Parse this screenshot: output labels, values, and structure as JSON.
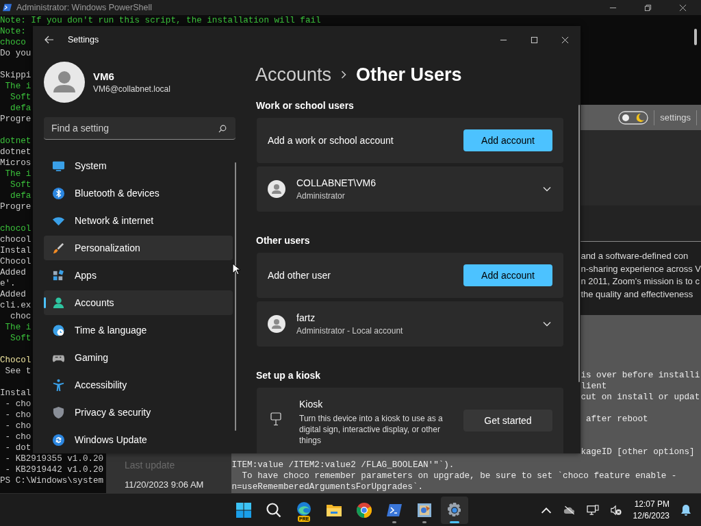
{
  "powershell": {
    "title": "Administrator: Windows PowerShell",
    "left_lines": [
      {
        "kind": "note",
        "text": "Note: If you don't run this script, the installation will fail"
      },
      {
        "kind": "note",
        "text": "Note:"
      },
      {
        "kind": "note",
        "text": "choco"
      },
      {
        "kind": "plain",
        "text": "Do you"
      },
      {
        "kind": "blank"
      },
      {
        "kind": "plain",
        "text": "Skippi"
      },
      {
        "kind": "note",
        "text": " The i"
      },
      {
        "kind": "note",
        "text": "  Soft"
      },
      {
        "kind": "note",
        "text": "  defa"
      },
      {
        "kind": "plain",
        "text": "Progre"
      },
      {
        "kind": "blank"
      },
      {
        "kind": "note",
        "text": "dotnet"
      },
      {
        "kind": "plain",
        "text": "dotnet"
      },
      {
        "kind": "plain",
        "text": "Micros"
      },
      {
        "kind": "note",
        "text": " The i"
      },
      {
        "kind": "note",
        "text": "  Soft"
      },
      {
        "kind": "note",
        "text": "  defa"
      },
      {
        "kind": "plain",
        "text": "Progre"
      },
      {
        "kind": "blank"
      },
      {
        "kind": "note",
        "text": "chocol"
      },
      {
        "kind": "plain",
        "text": "chocol"
      },
      {
        "kind": "plain",
        "text": "Instal"
      },
      {
        "kind": "plain",
        "text": "Chocol"
      },
      {
        "kind": "plain",
        "text": "Added"
      },
      {
        "kind": "plain",
        "text": "e'."
      },
      {
        "kind": "plain",
        "text": "Added"
      },
      {
        "kind": "plain",
        "text": "cli.ex"
      },
      {
        "kind": "plain",
        "text": "  choc"
      },
      {
        "kind": "note",
        "text": " The i"
      },
      {
        "kind": "note",
        "text": "  Soft"
      },
      {
        "kind": "blank"
      },
      {
        "kind": "warn",
        "text": "Chocol"
      },
      {
        "kind": "plain",
        "text": " See t"
      },
      {
        "kind": "blank"
      },
      {
        "kind": "plain",
        "text": "Instal"
      },
      {
        "kind": "plain",
        "text": " - cho"
      },
      {
        "kind": "plain",
        "text": " - cho"
      },
      {
        "kind": "plain",
        "text": " - cho"
      },
      {
        "kind": "plain",
        "text": " - cho"
      },
      {
        "kind": "plain",
        "text": " - dot"
      },
      {
        "kind": "plain",
        "text": " - KB2919355 v1.0.20"
      },
      {
        "kind": "plain",
        "text": " - KB2919442 v1.0.20"
      },
      {
        "kind": "plain",
        "text": "PS C:\\Windows\\system"
      }
    ],
    "right_lines": [
      {
        "kind": "plain",
        "text": "is over before installi"
      },
      {
        "kind": "plain",
        "text": "lient"
      },
      {
        "kind": "plain",
        "text": "cut on install or updat"
      },
      {
        "kind": "blank"
      },
      {
        "kind": "plain",
        "text": " after reboot"
      },
      {
        "kind": "blank"
      },
      {
        "kind": "blank"
      },
      {
        "kind": "plain",
        "text": "kageID [other options]"
      }
    ],
    "bottom_lines": [
      {
        "kind": "plain",
        "text": "ITEM:value /ITEM2:value2 /FLAG_BOOLEAN'\"`)."
      },
      {
        "kind": "plain",
        "text": "  To have choco remember parameters on upgrade, be sure to set `choco feature enable -"
      },
      {
        "kind": "plain",
        "text": "n=useRememberedArgumentsForUpgrades`."
      }
    ]
  },
  "browser": {
    "toolbar_links": [
      "settings"
    ],
    "description_lines": [
      "and a software-defined con",
      "n-sharing experience across V",
      "n 2011, Zoom's mission is to c",
      "the quality and effectiveness"
    ],
    "sidebar": {
      "label": "Last update",
      "value": "11/20/2023 9:06 AM"
    }
  },
  "settings": {
    "title": "Settings",
    "user": {
      "name": "VM6",
      "email": "VM6@collabnet.local"
    },
    "search": {
      "placeholder": "Find a setting"
    },
    "nav": [
      {
        "kind": "system",
        "label": "System",
        "selected": false,
        "hovered": false
      },
      {
        "kind": "bluetooth",
        "label": "Bluetooth & devices",
        "selected": false,
        "hovered": false
      },
      {
        "kind": "network",
        "label": "Network & internet",
        "selected": false,
        "hovered": false
      },
      {
        "kind": "personalization",
        "label": "Personalization",
        "selected": false,
        "hovered": true
      },
      {
        "kind": "apps",
        "label": "Apps",
        "selected": false,
        "hovered": false
      },
      {
        "kind": "accounts",
        "label": "Accounts",
        "selected": true,
        "hovered": false
      },
      {
        "kind": "time",
        "label": "Time & language",
        "selected": false,
        "hovered": false
      },
      {
        "kind": "gaming",
        "label": "Gaming",
        "selected": false,
        "hovered": false
      },
      {
        "kind": "accessibility",
        "label": "Accessibility",
        "selected": false,
        "hovered": false
      },
      {
        "kind": "privacy",
        "label": "Privacy & security",
        "selected": false,
        "hovered": false
      },
      {
        "kind": "update",
        "label": "Windows Update",
        "selected": false,
        "hovered": false
      }
    ],
    "breadcrumb": {
      "parent": "Accounts",
      "current": "Other Users"
    },
    "sections": [
      {
        "heading": "Work or school users",
        "cards": [
          {
            "kind": "action",
            "label": "Add a work or school account",
            "button": "Add account"
          },
          {
            "kind": "user",
            "name": "COLLABNET\\VM6",
            "role": "Administrator",
            "expanded": false
          }
        ]
      },
      {
        "heading": "Other users",
        "cards": [
          {
            "kind": "action",
            "label": "Add other user",
            "button": "Add account"
          },
          {
            "kind": "user",
            "name": "fartz",
            "role": "Administrator - Local account",
            "expanded": false
          }
        ]
      },
      {
        "heading": "Set up a kiosk",
        "cards": [
          {
            "kind": "kiosk",
            "title": "Kiosk",
            "description": "Turn this device into a kiosk to use as a digital sign, interactive display, or other things",
            "button": "Get started"
          }
        ]
      }
    ]
  },
  "taskbar": {
    "apps": [
      {
        "kind": "start",
        "running": false,
        "active": false
      },
      {
        "kind": "search",
        "running": false,
        "active": false
      },
      {
        "kind": "edge",
        "badge": "PRE",
        "running": false,
        "active": false
      },
      {
        "kind": "folder",
        "running": false,
        "active": false
      },
      {
        "kind": "chrome",
        "running": false,
        "active": false
      },
      {
        "kind": "powershell",
        "running": true,
        "active": false
      },
      {
        "kind": "paint",
        "running": true,
        "active": false
      },
      {
        "kind": "settings",
        "running": true,
        "active": true
      }
    ],
    "clock": {
      "time": "12:07 PM",
      "date": "12/6/2023"
    }
  }
}
